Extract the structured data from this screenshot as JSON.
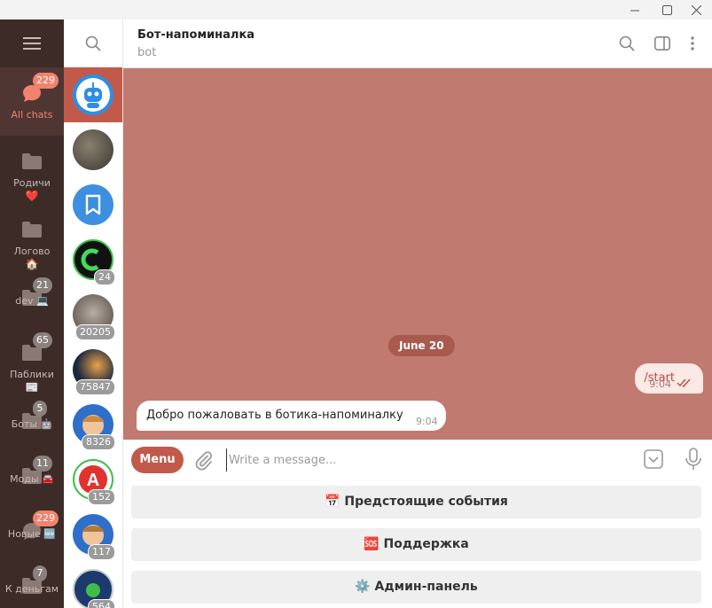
{
  "window": {
    "controls": [
      "minimize-icon",
      "maximize-icon",
      "close-icon"
    ]
  },
  "folders": {
    "items": [
      {
        "label": "All chats",
        "badge": "229",
        "icon": "chats-icon",
        "emoji": "",
        "active": true
      },
      {
        "label": "Родичи",
        "badge": "",
        "icon": "folder-icon",
        "emoji": "❤️",
        "active": false
      },
      {
        "label": "Логово",
        "badge": "",
        "icon": "folder-icon",
        "emoji": "🏠",
        "active": false
      },
      {
        "label": "dev 💻",
        "badge": "21",
        "icon": "folder-icon",
        "emoji": "",
        "active": false
      },
      {
        "label": "Паблики",
        "badge": "65",
        "icon": "folder-icon",
        "emoji": "📰",
        "active": false
      },
      {
        "label": "Боты 🤖",
        "badge": "5",
        "icon": "folder-icon",
        "emoji": "",
        "active": false
      },
      {
        "label": "Моды 🚘",
        "badge": "11",
        "icon": "folder-icon",
        "emoji": "",
        "active": false
      },
      {
        "label": "Новые 🆕",
        "badge": "229",
        "icon": "chats-icon",
        "emoji": "",
        "active": false
      },
      {
        "label": "К деньгам",
        "badge": "7",
        "icon": "folder-icon",
        "emoji": "",
        "active": false
      }
    ]
  },
  "chats": [
    {
      "avatar": "bot-avatar",
      "count": "",
      "active": true
    },
    {
      "avatar": "people-photo-avatar",
      "count": "",
      "active": false
    },
    {
      "avatar": "saved-messages-avatar",
      "count": "",
      "active": false
    },
    {
      "avatar": "logo-avatar",
      "count": "24",
      "active": false
    },
    {
      "avatar": "cat-avatar",
      "count": "20205",
      "active": false
    },
    {
      "avatar": "space-avatar",
      "count": "75847",
      "active": false
    },
    {
      "avatar": "memoji-avatar",
      "count": "8326",
      "active": false
    },
    {
      "avatar": "letter-a-avatar",
      "count": "152",
      "active": false
    },
    {
      "avatar": "memoji-avatar-2",
      "count": "117",
      "active": false
    },
    {
      "avatar": "badge-avatar",
      "count": "564",
      "active": false
    }
  ],
  "header": {
    "title": "Бот-напоминалка",
    "subtitle": "bot"
  },
  "messages": {
    "date": "June 20",
    "outgoing": {
      "text": "/start",
      "time": "9:04"
    },
    "incoming": {
      "text": "Добро пожаловать в ботика-напоминалку",
      "time": "9:04"
    }
  },
  "composer": {
    "menu_label": "Menu",
    "placeholder": "Write a message..."
  },
  "keyboard": {
    "buttons": [
      {
        "label": "📅 Предстоящие события"
      },
      {
        "label": "🆘 Поддержка"
      },
      {
        "label": "⚙️ Админ-панель"
      }
    ]
  },
  "colors": {
    "accent": "#c15a4a",
    "wallpaper": "#c07a70",
    "sidebar": "#3d2b28",
    "badge_active": "#f0836d"
  }
}
